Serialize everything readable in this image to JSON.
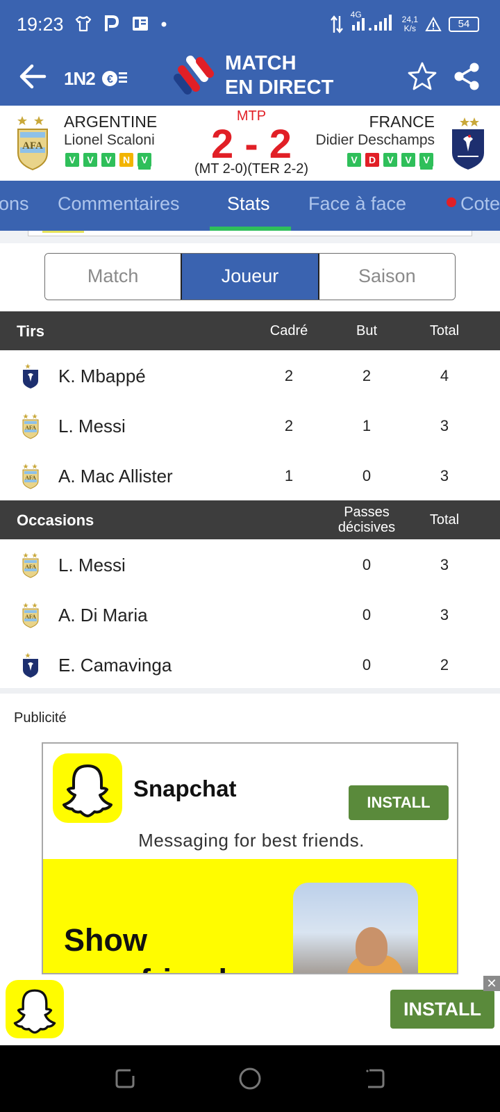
{
  "status_bar": {
    "time": "19:23",
    "network": "4G",
    "speed_value": "24,1",
    "speed_unit": "K/s",
    "battery": "54",
    "icons": [
      "shirt-icon",
      "parking-icon",
      "news-icon",
      "dot-icon",
      "data-arrows-icon",
      "signal-icon",
      "warning-icon",
      "battery-icon"
    ]
  },
  "app_bar": {
    "logo_1n2": "1N2",
    "title_line1": "MATCH",
    "title_line2": "EN DIRECT",
    "colors": {
      "primary": "#3a63b0",
      "accent_red": "#e11f26",
      "accent_green": "#2fbf5a"
    }
  },
  "match": {
    "status": "MTP",
    "score": "2 - 2",
    "detail": "(MT 2-0)(TER 2-2)",
    "home": {
      "name": "ARGENTINE",
      "coach": "Lionel Scaloni",
      "form": [
        {
          "r": "V",
          "color": "#2fbf5a"
        },
        {
          "r": "V",
          "color": "#2fbf5a"
        },
        {
          "r": "V",
          "color": "#2fbf5a"
        },
        {
          "r": "N",
          "color": "#f2b400"
        },
        {
          "r": "V",
          "color": "#2fbf5a"
        }
      ]
    },
    "away": {
      "name": "FRANCE",
      "coach": "Didier Deschamps",
      "form": [
        {
          "r": "V",
          "color": "#2fbf5a"
        },
        {
          "r": "D",
          "color": "#e11f26"
        },
        {
          "r": "V",
          "color": "#2fbf5a"
        },
        {
          "r": "V",
          "color": "#2fbf5a"
        },
        {
          "r": "V",
          "color": "#2fbf5a"
        }
      ]
    }
  },
  "tabs": {
    "items": [
      "ons",
      "Commentaires",
      "Stats",
      "Face à face",
      "Cote"
    ],
    "active": "Stats"
  },
  "segmented": {
    "items": [
      "Match",
      "Joueur",
      "Saison"
    ],
    "active": "Joueur"
  },
  "shots": {
    "title": "Tirs",
    "columns": [
      "Cadré",
      "But",
      "Total"
    ],
    "rows": [
      {
        "player": "K. Mbappé",
        "team": "france",
        "values": [
          "2",
          "2",
          "4"
        ]
      },
      {
        "player": "L. Messi",
        "team": "argentina",
        "values": [
          "2",
          "1",
          "3"
        ]
      },
      {
        "player": "A. Mac Allister",
        "team": "argentina",
        "values": [
          "1",
          "0",
          "3"
        ]
      }
    ]
  },
  "chances": {
    "title": "Occasions",
    "col_assists_line1": "Passes",
    "col_assists_line2": "décisives",
    "col_total": "Total",
    "rows": [
      {
        "player": "L. Messi",
        "team": "argentina",
        "values": [
          "0",
          "3"
        ]
      },
      {
        "player": "A. Di Maria",
        "team": "argentina",
        "values": [
          "0",
          "3"
        ]
      },
      {
        "player": "E. Camavinga",
        "team": "france",
        "values": [
          "0",
          "2"
        ]
      }
    ]
  },
  "ad": {
    "label": "Publicité",
    "app_name": "Snapchat",
    "install": "INSTALL",
    "tagline": "Messaging for best friends.",
    "headline_line1": "Show",
    "headline_line2": "your friends"
  },
  "banner": {
    "install": "INSTALL",
    "close": "✕"
  }
}
